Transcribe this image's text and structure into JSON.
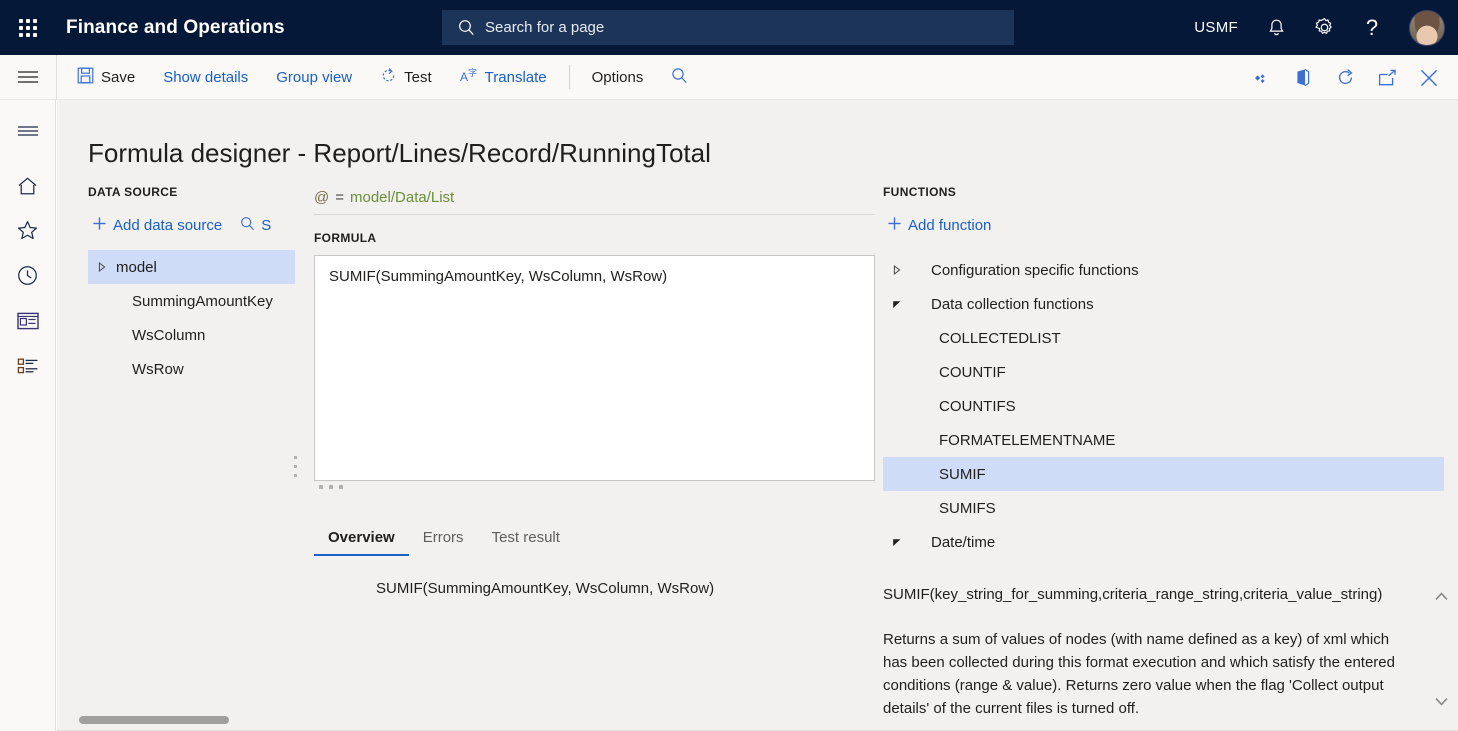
{
  "topbar": {
    "waffle_icon": "app-launcher-icon",
    "app_title": "Finance and Operations",
    "search": {
      "icon": "search-icon",
      "placeholder": "Search for a page",
      "value": ""
    },
    "company_code": "USMF",
    "notifications_icon": "bell-icon",
    "settings_icon": "gear-icon",
    "help_icon": "question-mark-icon",
    "avatar_icon": "user-avatar"
  },
  "commandbar": {
    "hamburger_icon": "hamburger-menu-icon",
    "buttons": [
      {
        "label": "Save",
        "icon": "save-disk-icon",
        "style": "dark"
      },
      {
        "label": "Show details",
        "icon": "",
        "style": "link"
      },
      {
        "label": "Group view",
        "icon": "",
        "style": "link"
      },
      {
        "label": "Test",
        "icon": "refresh-dotted-icon",
        "style": "dark"
      },
      {
        "label": "Translate",
        "icon": "translate-icon",
        "style": "link"
      },
      {
        "label": "Options",
        "icon": "",
        "style": "dark"
      }
    ],
    "search_icon": "search-icon",
    "right_icons": [
      "personalize-diamond-icon",
      "office-door-icon",
      "refresh-circle-icon",
      "open-in-new-window-icon",
      "close-x-icon"
    ]
  },
  "rail": {
    "items": [
      "hamburger-menu-icon",
      "home-icon",
      "star-favorites-icon",
      "clock-recent-icon",
      "workspaces-icon",
      "modules-list-icon"
    ]
  },
  "page": {
    "title": "Formula designer - Report/Lines/Record/RunningTotal"
  },
  "data_source": {
    "heading": "DATA SOURCE",
    "add_label": "Add data source",
    "add_icon": "plus-icon",
    "search_label": "S",
    "search_icon": "search-icon",
    "tree": [
      {
        "label": "model",
        "level": 0,
        "caret": "collapsed",
        "selected": true
      },
      {
        "label": "SummingAmountKey",
        "level": 1,
        "caret": "none",
        "selected": false
      },
      {
        "label": "WsColumn",
        "level": 1,
        "caret": "none",
        "selected": false
      },
      {
        "label": "WsRow",
        "level": 1,
        "caret": "none",
        "selected": false
      }
    ]
  },
  "formula": {
    "binding_at": "@",
    "binding_eq": "=",
    "binding_path": "model/Data/List",
    "heading": "FORMULA",
    "value": "SUMIF(SummingAmountKey, WsColumn, WsRow)",
    "tabs": [
      {
        "label": "Overview",
        "active": true
      },
      {
        "label": "Errors",
        "active": false
      },
      {
        "label": "Test result",
        "active": false
      }
    ],
    "overview_text": "SUMIF(SummingAmountKey, WsColumn, WsRow)"
  },
  "functions": {
    "heading": "FUNCTIONS",
    "add_label": "Add function",
    "add_icon": "plus-icon",
    "tree": [
      {
        "label": "Configuration specific functions",
        "type": "group",
        "caret": "collapsed",
        "selected": false
      },
      {
        "label": "Data collection functions",
        "type": "group",
        "caret": "expanded",
        "selected": false
      },
      {
        "label": "COLLECTEDLIST",
        "type": "leaf",
        "caret": "none",
        "selected": false
      },
      {
        "label": "COUNTIF",
        "type": "leaf",
        "caret": "none",
        "selected": false
      },
      {
        "label": "COUNTIFS",
        "type": "leaf",
        "caret": "none",
        "selected": false
      },
      {
        "label": "FORMATELEMENTNAME",
        "type": "leaf",
        "caret": "none",
        "selected": false
      },
      {
        "label": "SUMIF",
        "type": "leaf",
        "caret": "none",
        "selected": true
      },
      {
        "label": "SUMIFS",
        "type": "leaf",
        "caret": "none",
        "selected": false
      },
      {
        "label": "Date/time",
        "type": "group",
        "caret": "expanded",
        "selected": false
      }
    ]
  },
  "description": {
    "signature": "SUMIF(key_string_for_summing,criteria_range_string,criteria_value_string)",
    "body": "Returns a sum of values of nodes (with name defined as a key) of xml which has been collected during this format execution and which satisfy the entered conditions (range & value). Returns zero value when the flag 'Collect output details' of the current files is turned off.",
    "scroll_up_icon": "chevron-up-icon",
    "scroll_down_icon": "chevron-down-icon"
  },
  "colors": {
    "topbar_bg": "#061838",
    "search_bg": "#1d3459",
    "accent_link": "#1b60c4",
    "selection": "#cfdcf7",
    "workspace_bg": "#f2f1f0",
    "commandbar_bg": "#faf9f8"
  }
}
